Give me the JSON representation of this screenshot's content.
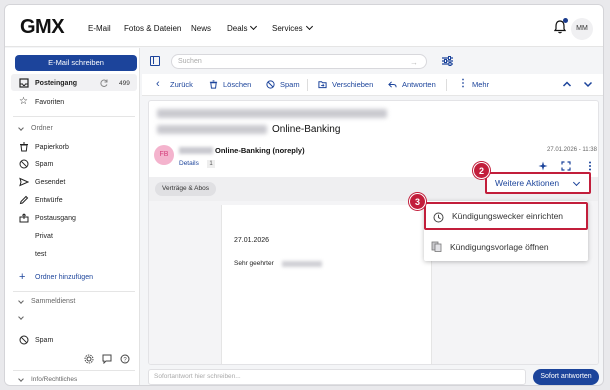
{
  "header": {
    "logo": "GMX",
    "nav": [
      "E-Mail",
      "Fotos & Dateien",
      "News",
      "Deals",
      "Services"
    ],
    "avatar_initials": "MM"
  },
  "sidebar": {
    "compose_label": "E-Mail schreiben",
    "inbox_label": "Posteingang",
    "inbox_count": "499",
    "favorites_label": "Favoriten",
    "folders_heading": "Ordner",
    "folders": [
      "Papierkorb",
      "Spam",
      "Gesendet",
      "Entwürfe",
      "Postausgang",
      "Privat",
      "test"
    ],
    "add_folder_label": "Ordner hinzufügen",
    "collection_heading": "Sammeldienst",
    "collection_spam_label": "Spam",
    "legal_heading": "Info/Rechtliches"
  },
  "search": {
    "placeholder": "Suchen"
  },
  "toolbar": {
    "back": "Zurück",
    "delete": "Löschen",
    "spam": "Spam",
    "move": "Verschieben",
    "reply": "Antworten",
    "more": "Mehr"
  },
  "mail": {
    "subject_visible": "Online-Banking",
    "avatar_initials": "FB",
    "sender_name": "Online-Banking (noreply)",
    "details_label": "Details",
    "details_count": "1",
    "date": "27.01.2026 - 11:38",
    "tag": "Verträge & Abos",
    "further_actions": "Weitere Aktionen",
    "body_date": "27.01.2026",
    "body_greeting": "Sehr geehrter"
  },
  "menu": {
    "items": [
      "Kündigungswecker einrichten",
      "Kündigungsvorlage öffnen"
    ]
  },
  "reply": {
    "placeholder": "Sofortantwort hier schreiben...",
    "button": "Sofort antworten"
  },
  "steps": [
    "2",
    "3"
  ],
  "colors": {
    "accent": "#1c449b",
    "highlight": "#c21e3b",
    "avatar_bg": "#f4b3cd"
  }
}
